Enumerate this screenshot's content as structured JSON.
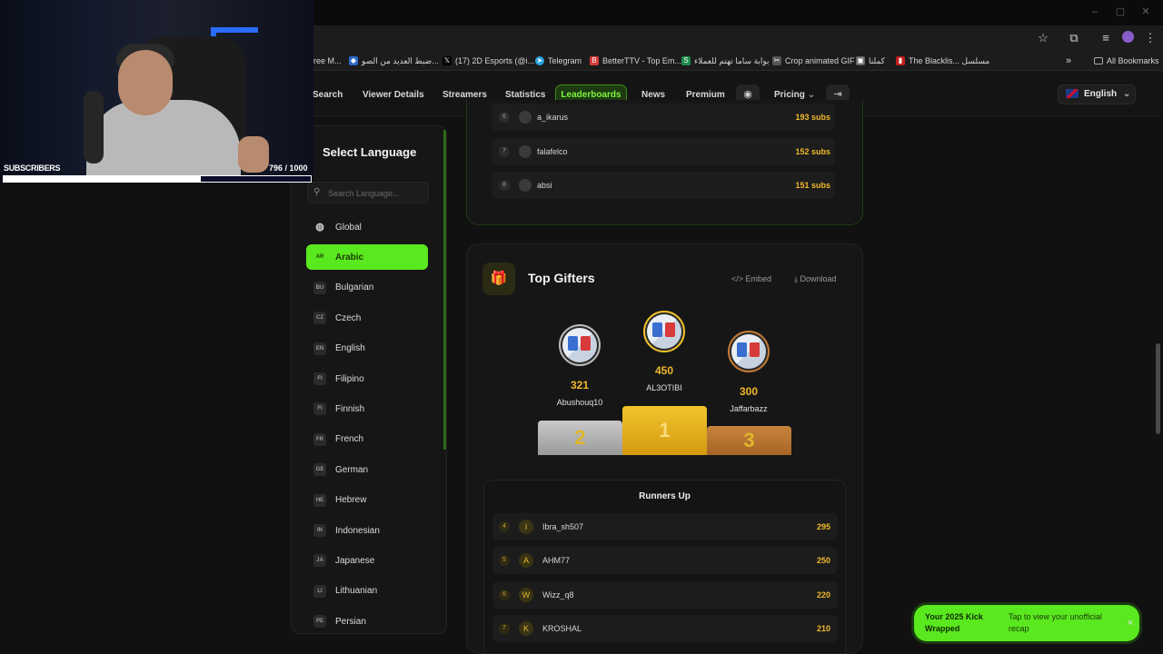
{
  "bookmarks": [
    {
      "label": "ree M...",
      "icon": ""
    },
    {
      "label": "ضبط العديد من الصو...",
      "icon": "diamond-icon"
    },
    {
      "label": "(17) 2D Esports (@i...",
      "icon": "x-icon"
    },
    {
      "label": "Telegram",
      "icon": "telegram-icon"
    },
    {
      "label": "BetterTTV - Top Em...",
      "icon": "bttv-icon"
    },
    {
      "label": "بوابة ساما تهتم للعملاء",
      "icon": "sama-icon"
    },
    {
      "label": "Crop animated GIF",
      "icon": "gif-icon"
    },
    {
      "label": "كملنا",
      "icon": "folder-icon"
    },
    {
      "label": "The Blacklis... مسلسل",
      "icon": "bookmark-icon"
    }
  ],
  "bookmarks_more": "»",
  "all_bookmarks": "All Bookmarks",
  "nav": {
    "items": [
      "Search",
      "Viewer Details",
      "Streamers",
      "Statistics",
      "Leaderboards",
      "News",
      "Premium"
    ],
    "pricing": "Pricing",
    "language": "English"
  },
  "language_panel": {
    "title": "Select Language",
    "search_placeholder": "Search Language...",
    "items": [
      {
        "code": "",
        "label": "Global",
        "icon": "globe-icon"
      },
      {
        "code": "AR",
        "label": "Arabic",
        "active": true
      },
      {
        "code": "BU",
        "label": "Bulgarian"
      },
      {
        "code": "CZ",
        "label": "Czech"
      },
      {
        "code": "EN",
        "label": "English"
      },
      {
        "code": "FI",
        "label": "Filipino"
      },
      {
        "code": "FI",
        "label": "Finnish"
      },
      {
        "code": "FR",
        "label": "French"
      },
      {
        "code": "GE",
        "label": "German"
      },
      {
        "code": "HE",
        "label": "Hebrew"
      },
      {
        "code": "IN",
        "label": "Indonesian"
      },
      {
        "code": "JA",
        "label": "Japanese"
      },
      {
        "code": "LI",
        "label": "Lithuanian"
      },
      {
        "code": "PE",
        "label": "Persian"
      }
    ]
  },
  "top_subs": [
    {
      "rank": "6",
      "name": "a_ikarus",
      "value": "193 subs"
    },
    {
      "rank": "7",
      "name": "falafelco",
      "value": "152 subs"
    },
    {
      "rank": "8",
      "name": "absi",
      "value": "151 subs"
    }
  ],
  "top_gifters": {
    "title": "Top Gifters",
    "embed": "Embed",
    "download": "Download",
    "podium": [
      {
        "place": "2",
        "value": "321",
        "name": "Abushouq10"
      },
      {
        "place": "1",
        "value": "450",
        "name": "AL3OTIBI"
      },
      {
        "place": "3",
        "value": "300",
        "name": "Jaffarbazz"
      }
    ],
    "runners_title": "Runners Up",
    "runners": [
      {
        "rank": "4",
        "initial": "I",
        "name": "Ibra_sh507",
        "value": "295"
      },
      {
        "rank": "5",
        "initial": "A",
        "name": "AHM77",
        "value": "250"
      },
      {
        "rank": "6",
        "initial": "W",
        "name": "Wizz_q8",
        "value": "220"
      },
      {
        "rank": "7",
        "initial": "K",
        "name": "KROSHAL",
        "value": "210"
      }
    ]
  },
  "toast": {
    "title": "Your 2025 Kick Wrapped",
    "text": "Tap to view your unofficial recap",
    "close": "×"
  },
  "overlay": {
    "label": "SUBSCRIBERS",
    "count": "796 / 1000",
    "progress": 0.796
  },
  "colors": {
    "accent": "#5ae81f",
    "gold": "#f0b92a",
    "silver": "#bdbdbd",
    "bronze": "#c47a34"
  }
}
